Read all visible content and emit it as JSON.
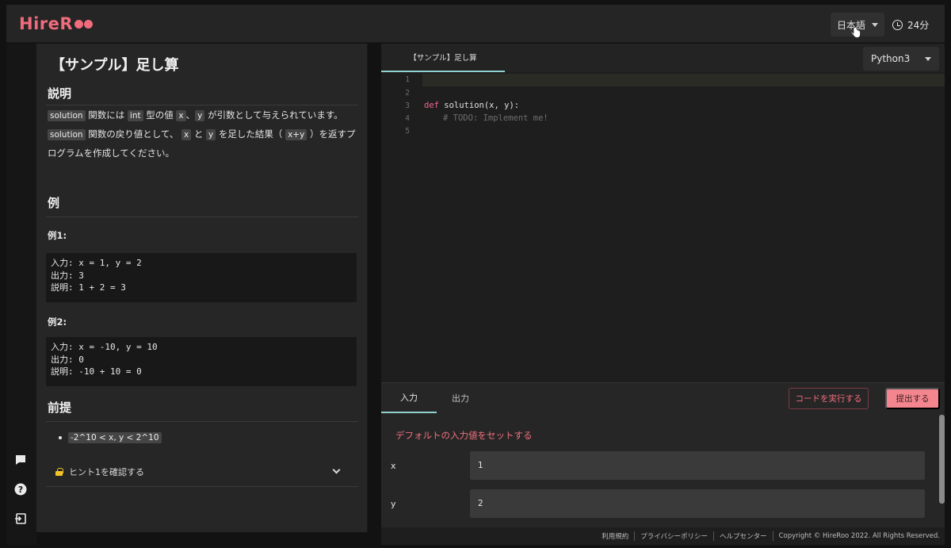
{
  "header": {
    "logo": "HireR",
    "language": "日本語",
    "timer": "24分"
  },
  "problem": {
    "title": "【サンプル】足し算",
    "description_heading": "説明",
    "description": {
      "p1_part1": "関数には",
      "p1_part2": "型の値",
      "p1_part3": "が引数として与えられています。",
      "p2_part1": "関数の戻り値として、",
      "p2_part2": "と",
      "p2_part3": "を足した結果（",
      "p2_part4": "）を返すプログラムを作成してください。",
      "chip_solution": "solution",
      "chip_int": "int",
      "chip_x": "x",
      "chip_y": "y",
      "chip_xy": "x+y",
      "comma": "、"
    },
    "examples_heading": "例",
    "examples": [
      {
        "label": "例1:",
        "body": "入力: x = 1, y = 2\n出力: 3\n説明: 1 + 2 = 3"
      },
      {
        "label": "例2:",
        "body": "入力: x = -10, y = 10\n出力: 0\n説明: -10 + 10 = 0"
      }
    ],
    "constraints_heading": "前提",
    "constraint": "-2^10 < x, y < 2^10",
    "hint": "ヒント1を確認する"
  },
  "editor": {
    "file_tab": "【サンプル】足し算",
    "language": "Python3",
    "line_numbers": [
      "1",
      "2",
      "3",
      "4",
      "5"
    ],
    "code_def": "def",
    "code_sig": " solution(x, y):",
    "code_comment": "# TODO: Implement me!"
  },
  "io": {
    "tab_input": "入力",
    "tab_output": "出力",
    "run_label": "コードを実行する",
    "submit_label": "提出する",
    "default_link": "デフォルトの入力値をセットする",
    "fields": [
      {
        "name": "x",
        "value": "1"
      },
      {
        "name": "y",
        "value": "2"
      }
    ]
  },
  "footer": {
    "terms": "利用規約",
    "privacy": "プライバシーポリシー",
    "help": "ヘルプセンター",
    "copyright": "Copyright © HireRoo 2022. All Rights Reserved."
  }
}
